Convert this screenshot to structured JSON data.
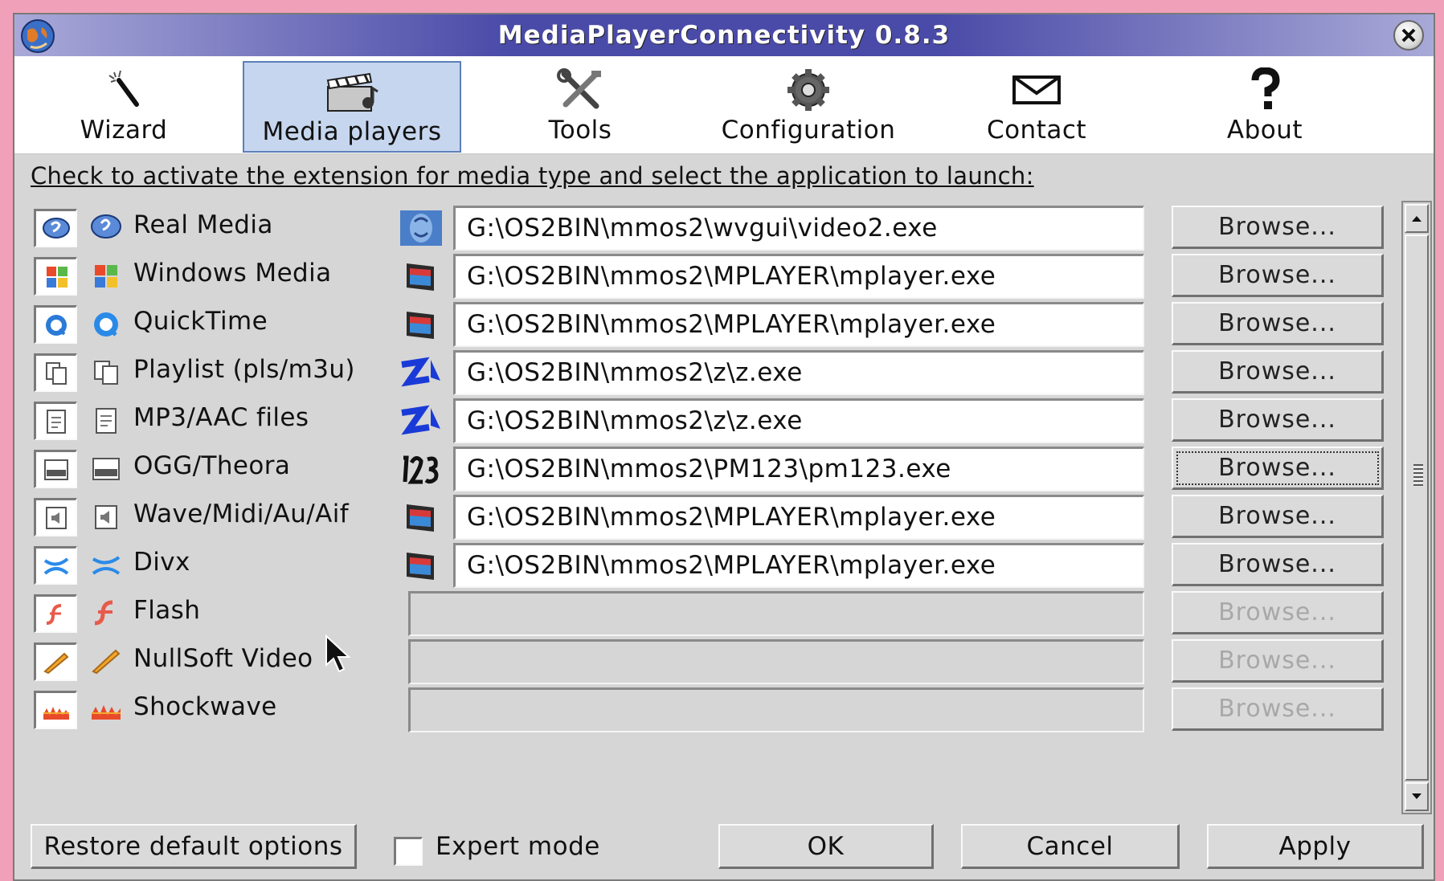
{
  "window": {
    "title": "MediaPlayerConnectivity 0.8.3"
  },
  "toolbar": {
    "items": [
      {
        "label": "Wizard",
        "icon": "wand-icon",
        "active": false
      },
      {
        "label": "Media players",
        "icon": "clapperboard-icon",
        "active": true
      },
      {
        "label": "Tools",
        "icon": "tools-icon",
        "active": false
      },
      {
        "label": "Configuration",
        "icon": "gear-icon",
        "active": false
      },
      {
        "label": "Contact",
        "icon": "envelope-icon",
        "active": false
      },
      {
        "label": "About",
        "icon": "question-icon",
        "active": false
      }
    ]
  },
  "instruction": "Check to activate the extension for media type and select the application to launch:",
  "media_types": [
    {
      "label": "Real Media",
      "icon": "realmedia-icon",
      "checked": true,
      "app_icon": "video2-app-icon",
      "path": "G:\\OS2BIN\\mmos2\\wvgui\\video2.exe",
      "browse": "Browse...",
      "enabled": true
    },
    {
      "label": "Windows Media",
      "icon": "windows-media-icon",
      "checked": true,
      "app_icon": "mplayer-app-icon",
      "path": "G:\\OS2BIN\\mmos2\\MPLAYER\\mplayer.exe",
      "browse": "Browse...",
      "enabled": true
    },
    {
      "label": "QuickTime",
      "icon": "quicktime-icon",
      "checked": true,
      "app_icon": "mplayer-app-icon",
      "path": "G:\\OS2BIN\\mmos2\\MPLAYER\\mplayer.exe",
      "browse": "Browse...",
      "enabled": true
    },
    {
      "label": "Playlist (pls/m3u)",
      "icon": "playlist-icon",
      "checked": true,
      "app_icon": "z-app-icon",
      "path": "G:\\OS2BIN\\mmos2\\z\\z.exe",
      "browse": "Browse...",
      "enabled": true
    },
    {
      "label": "MP3/AAC files",
      "icon": "mp3-icon",
      "checked": true,
      "app_icon": "z-app-icon",
      "path": "G:\\OS2BIN\\mmos2\\z\\z.exe",
      "browse": "Browse...",
      "enabled": true
    },
    {
      "label": "OGG/Theora",
      "icon": "ogg-icon",
      "checked": true,
      "app_icon": "pm123-app-icon",
      "path": "G:\\OS2BIN\\mmos2\\PM123\\pm123.exe",
      "browse": "Browse...",
      "enabled": true
    },
    {
      "label": "Wave/Midi/Au/Aif",
      "icon": "wave-icon",
      "checked": true,
      "app_icon": "mplayer-app-icon",
      "path": "G:\\OS2BIN\\mmos2\\MPLAYER\\mplayer.exe",
      "browse": "Browse...",
      "enabled": true
    },
    {
      "label": "Divx",
      "icon": "divx-icon",
      "checked": true,
      "app_icon": "mplayer-app-icon",
      "path": "G:\\OS2BIN\\mmos2\\MPLAYER\\mplayer.exe",
      "browse": "Browse...",
      "enabled": true
    },
    {
      "label": "Flash",
      "icon": "flash-icon",
      "checked": false,
      "app_icon": "",
      "path": "",
      "browse": "Browse...",
      "enabled": false
    },
    {
      "label": "NullSoft Video",
      "icon": "nullsoft-icon",
      "checked": false,
      "app_icon": "",
      "path": "",
      "browse": "Browse...",
      "enabled": false
    },
    {
      "label": "Shockwave",
      "icon": "shockwave-icon",
      "checked": false,
      "app_icon": "",
      "path": "",
      "browse": "Browse...",
      "enabled": false
    }
  ],
  "footer": {
    "restore_label": "Restore default options",
    "expert_label": "Expert mode",
    "expert_checked": false,
    "ok_label": "OK",
    "cancel_label": "Cancel",
    "apply_label": "Apply"
  },
  "colors": {
    "title_bar": "#4a4aa8",
    "active_tab": "#c6d6ee",
    "window_bg": "#d6d6d6",
    "desktop": "#f0a0b8"
  }
}
